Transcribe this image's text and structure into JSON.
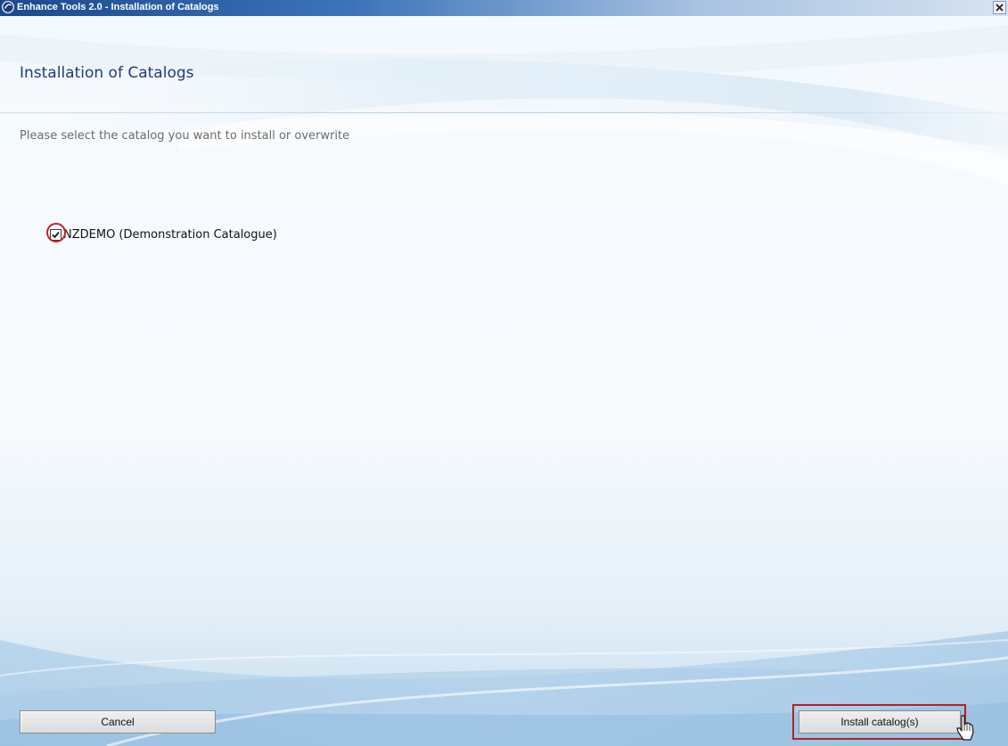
{
  "window": {
    "title": "Enhance Tools 2.0 - Installation of Catalogs",
    "icon": "app-logo-icon",
    "close_label": "✕"
  },
  "page": {
    "heading": "Installation of Catalogs",
    "instruction": "Please select the catalog you want to install or overwrite"
  },
  "catalogs": [
    {
      "label": "NZDEMO (Demonstration Catalogue)",
      "checked": true
    }
  ],
  "buttons": {
    "cancel": "Cancel",
    "install": "Install catalog(s)"
  },
  "colors": {
    "heading": "#1f3a80",
    "annotation": "#c42424",
    "titlebar_start": "#1a4a8c"
  }
}
